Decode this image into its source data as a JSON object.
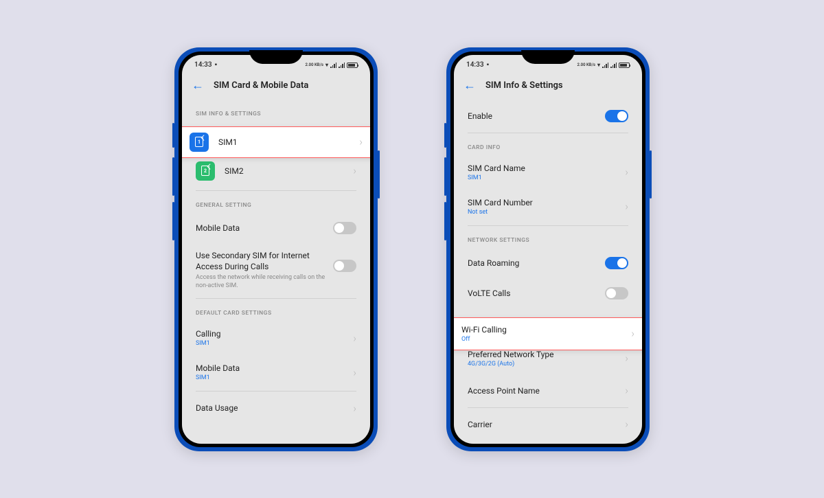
{
  "status": {
    "time": "14:33",
    "data_rate": "2.00 KB/s"
  },
  "phone1": {
    "title": "SIM Card & Mobile Data",
    "sections": {
      "sim_info": "SIM INFO & SETTINGS",
      "general": "GENERAL SETTING",
      "default_card": "DEFAULT CARD SETTINGS"
    },
    "sim1": "SIM1",
    "sim2": "SIM2",
    "mobile_data": "Mobile Data",
    "secondary_sim_title": "Use Secondary SIM for Internet Access During Calls",
    "secondary_sim_desc": "Access the network while receiving calls on the non-active SIM.",
    "calling": "Calling",
    "calling_sub": "SIM1",
    "mobile_data2": "Mobile Data",
    "mobile_data2_sub": "SIM1",
    "data_usage": "Data Usage"
  },
  "phone2": {
    "title": "SIM Info & Settings",
    "enable": "Enable",
    "sections": {
      "card_info": "CARD INFO",
      "network": "NETWORK SETTINGS"
    },
    "sim_card_name": "SIM Card Name",
    "sim_card_name_sub": "SIM1",
    "sim_card_number": "SIM Card Number",
    "sim_card_number_sub": "Not set",
    "data_roaming": "Data Roaming",
    "volte": "VoLTE Calls",
    "wifi_calling": "Wi-Fi Calling",
    "wifi_calling_sub": "Off",
    "pref_network": "Preferred Network Type",
    "pref_network_sub": "4G/3G/2G (Auto)",
    "apn": "Access Point Name",
    "carrier": "Carrier"
  }
}
